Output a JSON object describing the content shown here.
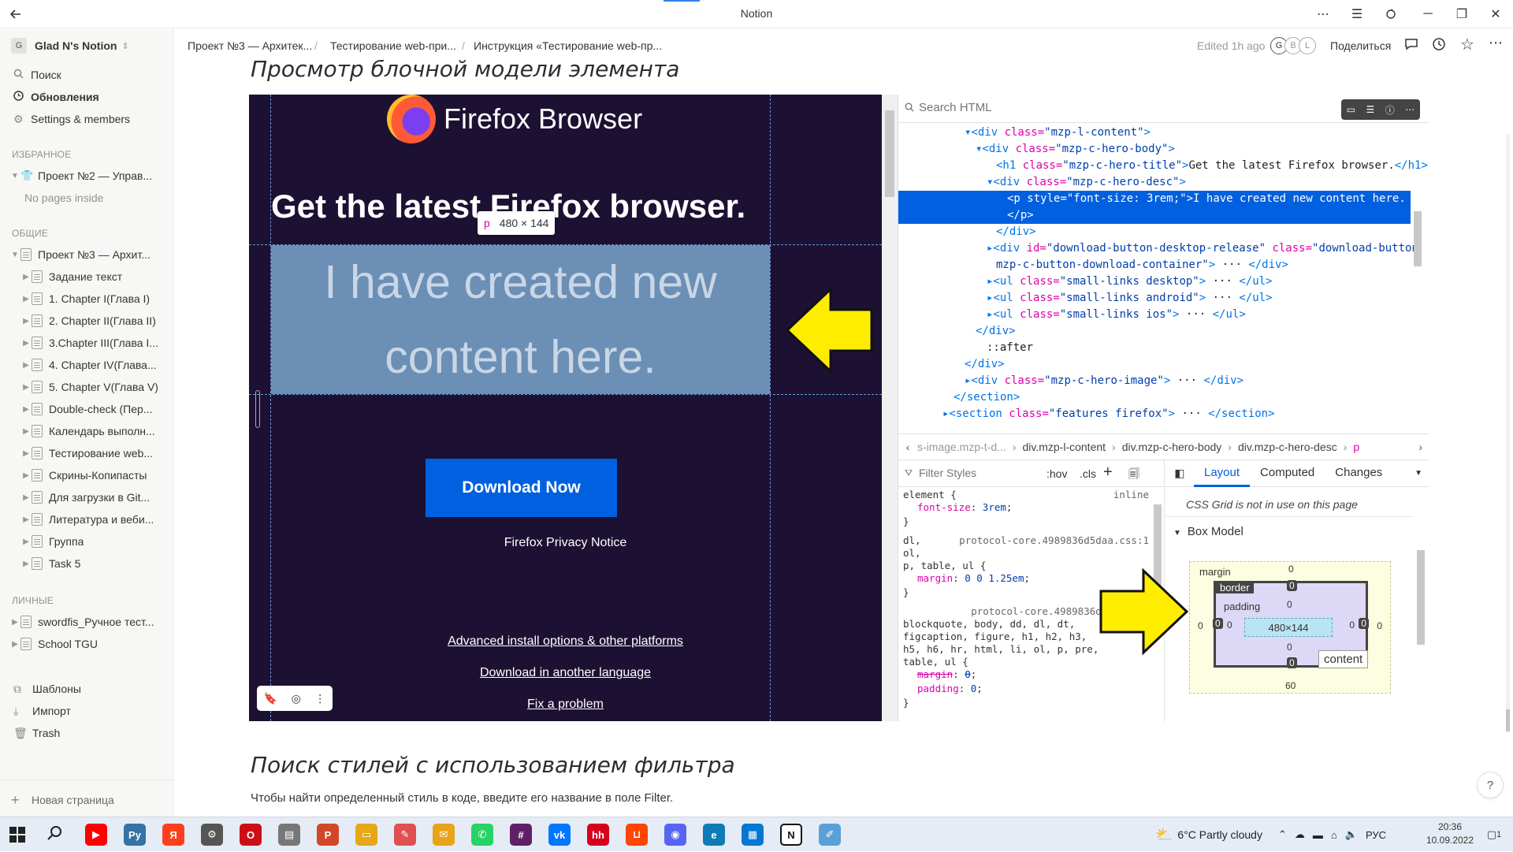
{
  "window": {
    "title": "Notion"
  },
  "sidebar": {
    "workspace": "Glad N's Notion",
    "workspace_initial": "G",
    "nav": [
      "Поиск",
      "Обновления",
      "Settings & members"
    ],
    "favorites_label": "ИЗБРАННОЕ",
    "favorite_page": "Проект №2 — Управ...",
    "no_pages": "No pages inside",
    "shared_label": "ОБЩИЕ",
    "shared_root": "Проект №3 — Архит...",
    "shared_children": [
      "Задание текст",
      "1. Chapter I(Глава I)",
      "2. Chapter II(Глава II)",
      "3.Chapter III(Глава I...",
      "4. Chapter IV(Глава...",
      "5. Chapter V(Глава V)",
      "Double-check (Пер...",
      "Календарь выполн...",
      "Тестирование web...",
      "Скрины-Копипасты",
      "Для загрузки в Git...",
      "Литература и веби...",
      "Группа",
      "Task 5"
    ],
    "private_label": "ЛИЧНЫЕ",
    "private_pages": [
      "swordfis_Ручное тест...",
      "School TGU"
    ],
    "bottom": [
      "Шаблоны",
      "Импорт",
      "Trash"
    ],
    "new_page": "Новая страница"
  },
  "topbar": {
    "breadcrumbs": [
      "Проект №3 — Архитек...",
      "Тестирование web-при...",
      "Инструкция «Тестирование web-пр..."
    ],
    "edited": "Edited 1h ago",
    "avatars": [
      "G",
      "B",
      "L"
    ],
    "share": "Поделиться"
  },
  "content": {
    "heading1": "Просмотр блочной модели элемента",
    "heading2": "Поиск стилей с использованием фильтра",
    "paragraph": "Чтобы найти определенный стиль в коде, введите его название в поле Filter.",
    "help": "?"
  },
  "firefox": {
    "brand": "Firefox Browser",
    "headline": "Get the latest Firefox browser.",
    "tooltip_tag": "p",
    "tooltip_size": "480 × 144",
    "highlight_text": "I have created new content here.",
    "download_btn": "Download Now",
    "privacy": "Firefox Privacy Notice",
    "links": [
      "Advanced install options & other platforms",
      "Download in another language",
      "Fix a problem"
    ]
  },
  "devtools": {
    "search_placeholder": "Search HTML",
    "dom": [
      {
        "parts": [
          [
            "tag",
            "▾<div "
          ],
          [
            "attr",
            "class="
          ],
          [
            "val",
            "\"mzp-l-content\""
          ],
          [
            "tag",
            ">"
          ]
        ]
      },
      {
        "parts": [
          [
            "tag",
            "▾<div "
          ],
          [
            "attr",
            "class="
          ],
          [
            "val",
            "\"mzp-c-hero-body\""
          ],
          [
            "tag",
            ">"
          ]
        ]
      },
      {
        "parts": [
          [
            "tag",
            "<h1 "
          ],
          [
            "attr",
            "class="
          ],
          [
            "val",
            "\"mzp-c-hero-title\""
          ],
          [
            "tag",
            ">"
          ],
          [
            "txt",
            "Get the latest Firefox browser."
          ],
          [
            "tag",
            "</h1>"
          ]
        ]
      },
      {
        "parts": [
          [
            "tag",
            "▾<div "
          ],
          [
            "attr",
            "class="
          ],
          [
            "val",
            "\"mzp-c-hero-desc\""
          ],
          [
            "tag",
            ">"
          ]
        ]
      },
      {
        "parts": [
          [
            "tag",
            "<p "
          ],
          [
            "attr",
            "style="
          ],
          [
            "val",
            "\"font-size: 3rem;\""
          ],
          [
            "tag",
            ">"
          ],
          [
            "txt",
            "I have created new content here."
          ]
        ]
      },
      {
        "parts": [
          [
            "tag",
            "</p>"
          ]
        ]
      },
      {
        "parts": [
          [
            "tag",
            "</div>"
          ]
        ]
      },
      {
        "parts": [
          [
            "tag",
            "▸<div "
          ],
          [
            "attr",
            "id="
          ],
          [
            "val",
            "\"download-button-desktop-release\" "
          ],
          [
            "attr",
            "class="
          ],
          [
            "val",
            "\"download-button"
          ]
        ]
      },
      {
        "parts": [
          [
            "val",
            "mzp-c-button-download-container\""
          ],
          [
            "tag",
            ">"
          ],
          [
            "txt",
            " ··· "
          ],
          [
            "tag",
            "</div>"
          ]
        ]
      },
      {
        "parts": [
          [
            "tag",
            "▸<ul "
          ],
          [
            "attr",
            "class="
          ],
          [
            "val",
            "\"small-links desktop\""
          ],
          [
            "tag",
            ">"
          ],
          [
            "txt",
            " ··· "
          ],
          [
            "tag",
            "</ul>"
          ]
        ]
      },
      {
        "parts": [
          [
            "tag",
            "▸<ul "
          ],
          [
            "attr",
            "class="
          ],
          [
            "val",
            "\"small-links android\""
          ],
          [
            "tag",
            ">"
          ],
          [
            "txt",
            " ··· "
          ],
          [
            "tag",
            "</ul>"
          ]
        ]
      },
      {
        "parts": [
          [
            "tag",
            "▸<ul "
          ],
          [
            "attr",
            "class="
          ],
          [
            "val",
            "\"small-links ios\""
          ],
          [
            "tag",
            ">"
          ],
          [
            "txt",
            " ··· "
          ],
          [
            "tag",
            "</ul>"
          ]
        ]
      },
      {
        "parts": [
          [
            "tag",
            "</div>"
          ]
        ]
      },
      {
        "parts": [
          [
            "txt",
            "::after"
          ]
        ]
      },
      {
        "parts": [
          [
            "tag",
            "</div>"
          ]
        ]
      },
      {
        "parts": [
          [
            "tag",
            "▸<div "
          ],
          [
            "attr",
            "class="
          ],
          [
            "val",
            "\"mzp-c-hero-image\""
          ],
          [
            "tag",
            ">"
          ],
          [
            "txt",
            " ··· "
          ],
          [
            "tag",
            "</div>"
          ]
        ]
      },
      {
        "parts": [
          [
            "tag",
            "</section>"
          ]
        ]
      },
      {
        "parts": [
          [
            "tag",
            "▸<section "
          ],
          [
            "attr",
            "class="
          ],
          [
            "val",
            "\"features firefox\""
          ],
          [
            "tag",
            ">"
          ],
          [
            "txt",
            " ··· "
          ],
          [
            "tag",
            "</section>"
          ]
        ]
      }
    ],
    "breadcrumbs": [
      "s-image.mzp-t-d...",
      "div.mzp-l-content",
      "div.mzp-c-hero-body",
      "div.mzp-c-hero-desc",
      "p"
    ],
    "filter_placeholder": "Filter Styles",
    "hov": ":hov",
    "cls": ".cls",
    "rules": [
      {
        "sel": "element",
        "src": "inline",
        "decls": [
          [
            "font-size",
            "3rem"
          ]
        ]
      },
      {
        "sel": "dl,",
        "src": "protocol-core.4989836d5daa.css:1",
        "extra": [
          "ol,",
          "p, table, ul"
        ],
        "decls": [
          [
            "margin",
            "0 0 1.25em"
          ]
        ]
      },
      {
        "sel": "",
        "src": "protocol-core.4989836d5daa.css",
        "extra": [
          "blockquote, body, dd, dl, dt,",
          "figcaption, figure, h1, h2, h3,",
          "h5, h6, hr, html, li, ol, p, pre,",
          "table, ul"
        ],
        "decls": [
          [
            "margin",
            "0"
          ],
          [
            "padding",
            "0"
          ]
        ]
      }
    ],
    "tabs": [
      "Layout",
      "Computed",
      "Changes"
    ],
    "grid_note": "CSS Grid is not in use on this page",
    "box_model": "Box Model",
    "bm": {
      "margin": "margin",
      "border": "border",
      "padding": "padding",
      "content": "content",
      "size": "480×144",
      "bottom_margin": "60",
      "zero": "0"
    }
  },
  "taskbar": {
    "weather": "6°C  Partly cloudy",
    "lang": "РУС",
    "time": "20:36",
    "date": "10.09.2022",
    "notif": "1"
  }
}
